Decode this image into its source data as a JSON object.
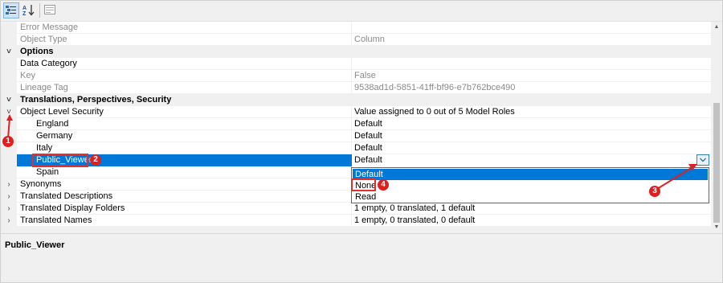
{
  "toolbar": {
    "categorized_icon": "categorized-view-icon",
    "alphabetical_icon": "sort-alphabetical-icon",
    "property_pages_icon": "property-pages-icon"
  },
  "properties": {
    "error_message": {
      "name": "Error Message",
      "value": ""
    },
    "object_type": {
      "name": "Object Type",
      "value": "Column"
    },
    "options_header": "Options",
    "data_category": {
      "name": "Data Category",
      "value": ""
    },
    "key": {
      "name": "Key",
      "value": "False"
    },
    "lineage_tag": {
      "name": "Lineage Tag",
      "value": "9538ad1d-5851-41ff-bf96-e7b762bce490"
    },
    "tps_header": "Translations, Perspectives, Security",
    "object_level_security": {
      "name": "Object Level Security",
      "value": "Value assigned to 0 out of 5 Model Roles"
    },
    "roles": [
      {
        "name": "England",
        "value": "Default"
      },
      {
        "name": "Germany",
        "value": "Default"
      },
      {
        "name": "Italy",
        "value": "Default"
      },
      {
        "name": "Public_Viewer",
        "value": "Default"
      },
      {
        "name": "Spain",
        "value": ""
      }
    ],
    "synonyms": {
      "name": "Synonyms",
      "value": ""
    },
    "translated_descriptions": {
      "name": "Translated Descriptions",
      "value": ""
    },
    "translated_display_folders": {
      "name": "Translated Display Folders",
      "value": "1 empty, 0 translated, 1 default"
    },
    "translated_names": {
      "name": "Translated Names",
      "value": "1 empty, 0 translated, 0 default"
    }
  },
  "dropdown": {
    "options": [
      "Default",
      "None",
      "Read"
    ],
    "selected": "Default"
  },
  "description": {
    "title": "Public_Viewer"
  },
  "annotations": [
    "1",
    "2",
    "3",
    "4"
  ],
  "colors": {
    "selection": "#0078d7",
    "annotation": "#e02020"
  }
}
